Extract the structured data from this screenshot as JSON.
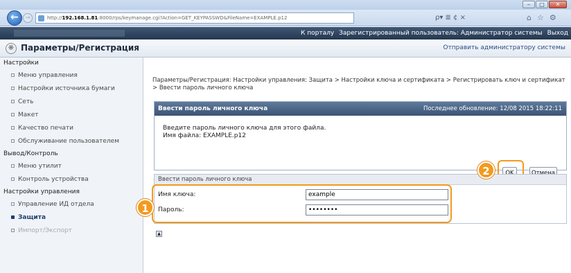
{
  "browser": {
    "address_prefix": "http://",
    "address_host": "192.168.1.81",
    "address_rest": ":8000/rps/keymanage.cgi?Action=GET_KEYPASSWD&FileName=EXAMPLE.p12",
    "search_glyphs": "ρ▾ ≣ ¢ ×",
    "minimize": "‒",
    "maximize": "□",
    "close": "✕"
  },
  "topbar": {
    "portal_link": "К порталу",
    "logged_in_as": "Зарегистрированный пользователь: Администратор системы",
    "logout": "Выход"
  },
  "header": {
    "title": "Параметры/Регистрация",
    "admin_link": "Отправить администратору системы"
  },
  "sidebar": {
    "sections": [
      {
        "label": "Настройки",
        "items": [
          {
            "label": "Меню управления"
          },
          {
            "label": "Настройки источника бумаги"
          },
          {
            "label": "Сеть"
          },
          {
            "label": "Макет"
          },
          {
            "label": "Качество печати"
          },
          {
            "label": "Обслуживание пользователем"
          }
        ]
      },
      {
        "label": "Вывод/Контроль",
        "items": [
          {
            "label": "Меню утилит"
          },
          {
            "label": "Контроль устройства"
          }
        ]
      },
      {
        "label": "Настройки управления",
        "items": [
          {
            "label": "Управление ИД отдела"
          },
          {
            "label": "Защита"
          },
          {
            "label": "Импорт/Экспорт"
          }
        ]
      }
    ]
  },
  "main": {
    "breadcrumb": "Параметры/Регистрация: Настройки управления: Защита > Настройки ключа и сертификата > Регистрировать ключ и сертификат > Ввести пароль личного ключа",
    "panel_title": "Ввести пароль личного ключа",
    "last_updated": "Последнее обновление: 12/08 2015 18:22:11",
    "instruction": "Введите пароль личного ключа для этого файла.",
    "filename_line": "Имя файла: EXAMPLE.p12",
    "ok_label": "OK",
    "cancel_label": "Отмена",
    "form_title": "Ввести пароль личного ключа",
    "key_name_label": "Имя ключа:",
    "key_name_value": "example",
    "password_label": "Пароль:",
    "password_value": "••••••••"
  },
  "callouts": {
    "one": "1",
    "two": "2"
  },
  "colors": {
    "accent": "#f39a1e",
    "panel_header": "#3c5474",
    "topbar": "#25374f"
  }
}
